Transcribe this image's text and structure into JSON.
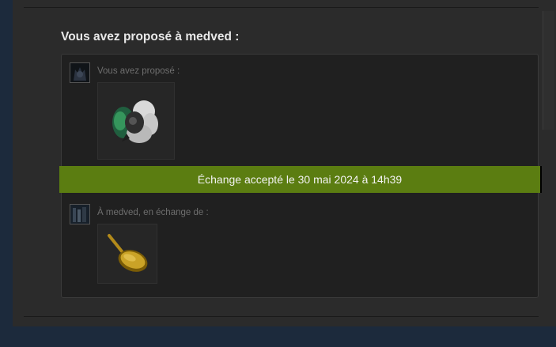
{
  "trade": {
    "title": "Vous avez proposé à medved :",
    "you_offered_label": "Vous avez proposé :",
    "they_gave_label": "À medved, en échange de :",
    "status_banner": "Échange accepté le 30 mai 2024 à 14h39",
    "items_offered": [
      {
        "icon": "smoke-cosmetic-item-icon"
      }
    ],
    "items_received": [
      {
        "icon": "frying-pan-item-icon"
      }
    ]
  },
  "colors": {
    "banner": "#5b7d11",
    "panel": "#2b2b2b",
    "box": "#202020",
    "page": "#1c2a3c"
  }
}
